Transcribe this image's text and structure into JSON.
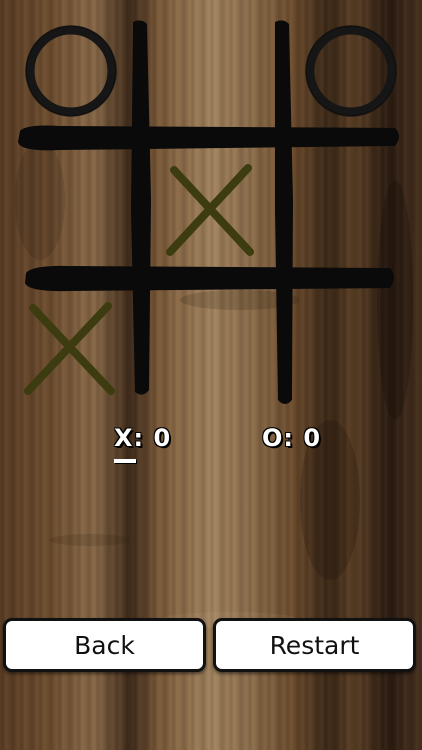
{
  "game": "tic-tac-toe",
  "board": {
    "cells": [
      [
        "O",
        "",
        "O"
      ],
      [
        "",
        "X",
        ""
      ],
      [
        "X",
        "",
        ""
      ]
    ],
    "x_color": "#3d3c10",
    "o_color": "#161616",
    "line_color": "#0a0a0a"
  },
  "scores": {
    "x_text": "X: 0",
    "o_text": "O: 0",
    "current_turn": "X"
  },
  "buttons": {
    "back_label": "Back",
    "restart_label": "Restart"
  },
  "colors": {
    "score_text": "#ffffff",
    "button_bg": "#ffffff",
    "button_border": "#111111"
  }
}
